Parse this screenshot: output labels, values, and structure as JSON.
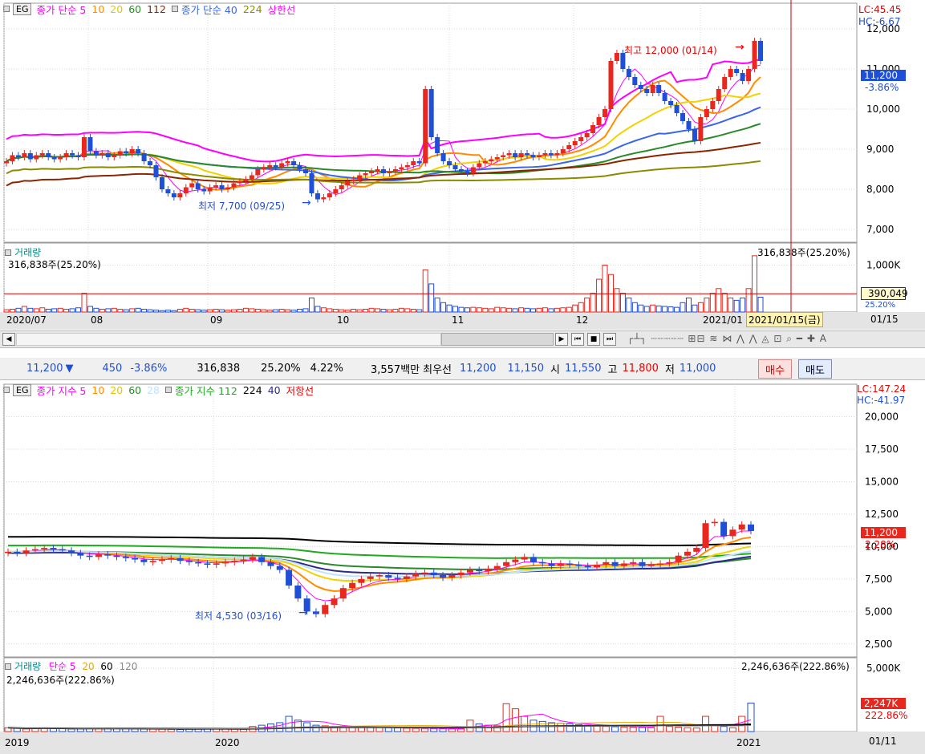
{
  "colors": {
    "up": "#e8281e",
    "down": "#1f4fd6",
    "ma5": "#ff00ff",
    "ma10": "#ff8c00",
    "ma20": "#f2d200",
    "ma60": "#2a8a2a",
    "ma112": "#8b2500",
    "ma40": "#3a66e8",
    "ma224": "#8b8b00",
    "grid": "#d8d8d8",
    "crosshair": "#cc0000",
    "axis_text": "#000000"
  },
  "top_chart": {
    "legend": {
      "eg": "EG",
      "prefix": "종가 단순 5",
      "m10": "10",
      "m20": "20",
      "m60": "60",
      "m112": "112",
      "prefix2": "종가 단순 40",
      "m224": "224",
      "upper": "상한선"
    },
    "lc": "LC:45.45",
    "hc": "HC:-6.67",
    "yticks": [
      "12,000",
      "11,000",
      "10,000",
      "9,000",
      "8,000",
      "7,000"
    ],
    "price_badge": "11,200",
    "price_change": "-3.86%",
    "annot_high": "최고 12,000 (01/14)",
    "annot_low": "최저 7,700 (09/25)",
    "volume_legend": "거래량",
    "volume_value": "316,838주(25.20%)",
    "volume_value_right": "316,838주(25.20%)",
    "volume_tick": "1,000K",
    "volume_badge": "390,049",
    "volume_badge2": "25.20%",
    "xlabels": [
      "2020/07",
      "08",
      "09",
      "10",
      "11",
      "12",
      "2021/01"
    ],
    "x_right": "01/15",
    "crosshair_date": "2021/01/15(금)"
  },
  "infobar": {
    "price": "11,200",
    "arrow": "▼",
    "change": "450",
    "change_pct": "-3.86%",
    "volume": "316,838",
    "vol_ratio": "25.20%",
    "turnover": "4.22%",
    "amount": "3,557백만",
    "best_label": "최우선",
    "best_ask": "11,200",
    "best_bid": "11,150",
    "open_label": "시",
    "open": "11,550",
    "high_label": "고",
    "high": "11,800",
    "low_label": "저",
    "low": "11,000",
    "buy": "매수",
    "sell": "매도"
  },
  "bottom_chart": {
    "legend": {
      "eg": "EG",
      "prefix": "종가 지수 5",
      "m10": "10",
      "m20": "20",
      "m60": "60",
      "m28": "28",
      "prefix2": "종가 지수 112",
      "m224": "224",
      "m40": "40",
      "resist": "저항선"
    },
    "lc": "LC:147.24",
    "hc": "HC:-41.97",
    "yticks": [
      "20,000",
      "17,500",
      "15,000",
      "12,500",
      "10,000",
      "7,500",
      "5,000",
      "2,500"
    ],
    "price_badge": "11,200",
    "price_change": "2.28%",
    "annot_low": "최저 4,530 (03/16)",
    "volume_legend": "거래량",
    "vol_ma_label": "단순 5",
    "vol_m20": "20",
    "vol_m60": "60",
    "vol_m120": "120",
    "volume_value": "2,246,636주(222.86%)",
    "volume_value_right": "2,246,636주(222.86%)",
    "volume_tick": "5,000K",
    "volume_badge": "2,247K",
    "volume_badge2": "222.86%",
    "xlabels": [
      "2019",
      "2020",
      "2021"
    ],
    "x_right": "01/11"
  },
  "chart_data": [
    {
      "type": "candlestick",
      "title": "",
      "period": "daily 2020/07 - 2021/01/15",
      "ylim": [
        6800,
        12400
      ],
      "ma_periods": [
        5,
        10,
        20,
        60,
        112,
        40,
        224
      ],
      "annotations": [
        {
          "text": "최고 12,000 (01/14)"
        },
        {
          "text": "최저 7,700 (09/25)"
        }
      ],
      "last_price": 11200,
      "closes": [
        8700,
        8850,
        8800,
        8900,
        8750,
        8850,
        8900,
        8800,
        8750,
        8800,
        8900,
        8850,
        8800,
        9300,
        8950,
        8850,
        8900,
        8800,
        8850,
        8950,
        8900,
        9000,
        8900,
        8700,
        8600,
        8300,
        8000,
        7900,
        7800,
        7900,
        8050,
        8150,
        8000,
        7950,
        8050,
        8100,
        8000,
        8050,
        8150,
        8200,
        8250,
        8350,
        8500,
        8550,
        8600,
        8550,
        8650,
        8700,
        8600,
        8500,
        8400,
        7900,
        7750,
        7800,
        7900,
        8000,
        8100,
        8200,
        8250,
        8350,
        8400,
        8450,
        8500,
        8400,
        8450,
        8500,
        8550,
        8600,
        8700,
        8650,
        10500,
        9300,
        8900,
        8700,
        8600,
        8500,
        8450,
        8400,
        8550,
        8650,
        8700,
        8750,
        8800,
        8850,
        8900,
        8800,
        8900,
        8850,
        8800,
        8850,
        8900,
        8850,
        8900,
        9000,
        9100,
        9200,
        9300,
        9400,
        9600,
        9800,
        10000,
        11200,
        11400,
        11000,
        10800,
        10600,
        10500,
        10400,
        10600,
        10400,
        10200,
        10100,
        9900,
        9700,
        9500,
        9200,
        9800,
        10000,
        10200,
        10500,
        10800,
        11000,
        10900,
        10700,
        11000,
        11700,
        11200
      ],
      "volumes": [
        50,
        60,
        80,
        120,
        80,
        70,
        90,
        60,
        70,
        80,
        60,
        70,
        90,
        400,
        120,
        80,
        60,
        70,
        80,
        60,
        50,
        70,
        80,
        60,
        50,
        40,
        30,
        40,
        30,
        60,
        80,
        60,
        50,
        40,
        50,
        60,
        50,
        40,
        50,
        60,
        80,
        70,
        60,
        50,
        40,
        50,
        60,
        50,
        40,
        60,
        70,
        300,
        120,
        90,
        70,
        60,
        50,
        40,
        60,
        50,
        60,
        80,
        70,
        60,
        50,
        60,
        80,
        70,
        60,
        50,
        900,
        600,
        300,
        200,
        150,
        120,
        100,
        90,
        100,
        90,
        80,
        70,
        100,
        90,
        80,
        70,
        90,
        80,
        70,
        80,
        90,
        70,
        80,
        90,
        100,
        150,
        200,
        300,
        400,
        700,
        1000,
        800,
        500,
        400,
        300,
        200,
        150,
        120,
        150,
        130,
        120,
        110,
        100,
        200,
        300,
        150,
        200,
        300,
        400,
        500,
        400,
        300,
        250,
        300,
        500,
        1200,
        316.8
      ]
    },
    {
      "type": "candlestick",
      "title": "",
      "period": "weekly 2019 - 2021/01",
      "ylim": [
        1500,
        22500
      ],
      "ma_periods": [
        5,
        10,
        20,
        60,
        112,
        224,
        40
      ],
      "annotations": [
        {
          "text": "최저 4,530 (03/16)"
        }
      ],
      "last_price": 11200,
      "closes": [
        9600,
        9500,
        9700,
        9800,
        9900,
        9800,
        9700,
        9500,
        9300,
        9200,
        9400,
        9300,
        9200,
        9100,
        9000,
        8800,
        8900,
        9000,
        9100,
        8900,
        8800,
        8700,
        8600,
        8700,
        8800,
        8900,
        9000,
        9200,
        8800,
        8500,
        8200,
        7000,
        6000,
        5000,
        4800,
        5500,
        6000,
        6800,
        7200,
        7500,
        7700,
        7800,
        7600,
        7500,
        7700,
        7900,
        8000,
        7800,
        7600,
        7800,
        8000,
        8200,
        8100,
        8300,
        8500,
        8800,
        9000,
        9200,
        8800,
        8700,
        8500,
        8700,
        8600,
        8500,
        8400,
        8600,
        8800,
        8500,
        8700,
        8800,
        8500,
        8600,
        8700,
        8800,
        9300,
        9600,
        9900,
        11800,
        11900,
        10800,
        11300,
        11700,
        11200
      ],
      "volumes": [
        300,
        250,
        200,
        280,
        260,
        240,
        220,
        200,
        210,
        230,
        250,
        260,
        230,
        220,
        210,
        200,
        190,
        180,
        170,
        160,
        180,
        190,
        200,
        210,
        190,
        180,
        170,
        400,
        500,
        600,
        700,
        1200,
        900,
        700,
        500,
        450,
        400,
        380,
        360,
        340,
        330,
        320,
        300,
        280,
        260,
        250,
        240,
        230,
        220,
        210,
        200,
        900,
        600,
        500,
        450,
        2200,
        1800,
        1200,
        900,
        800,
        700,
        650,
        600,
        550,
        500,
        450,
        400,
        380,
        360,
        340,
        330,
        320,
        1200,
        400,
        350,
        300,
        280,
        1200,
        500,
        400,
        300,
        1200,
        2247
      ]
    }
  ]
}
